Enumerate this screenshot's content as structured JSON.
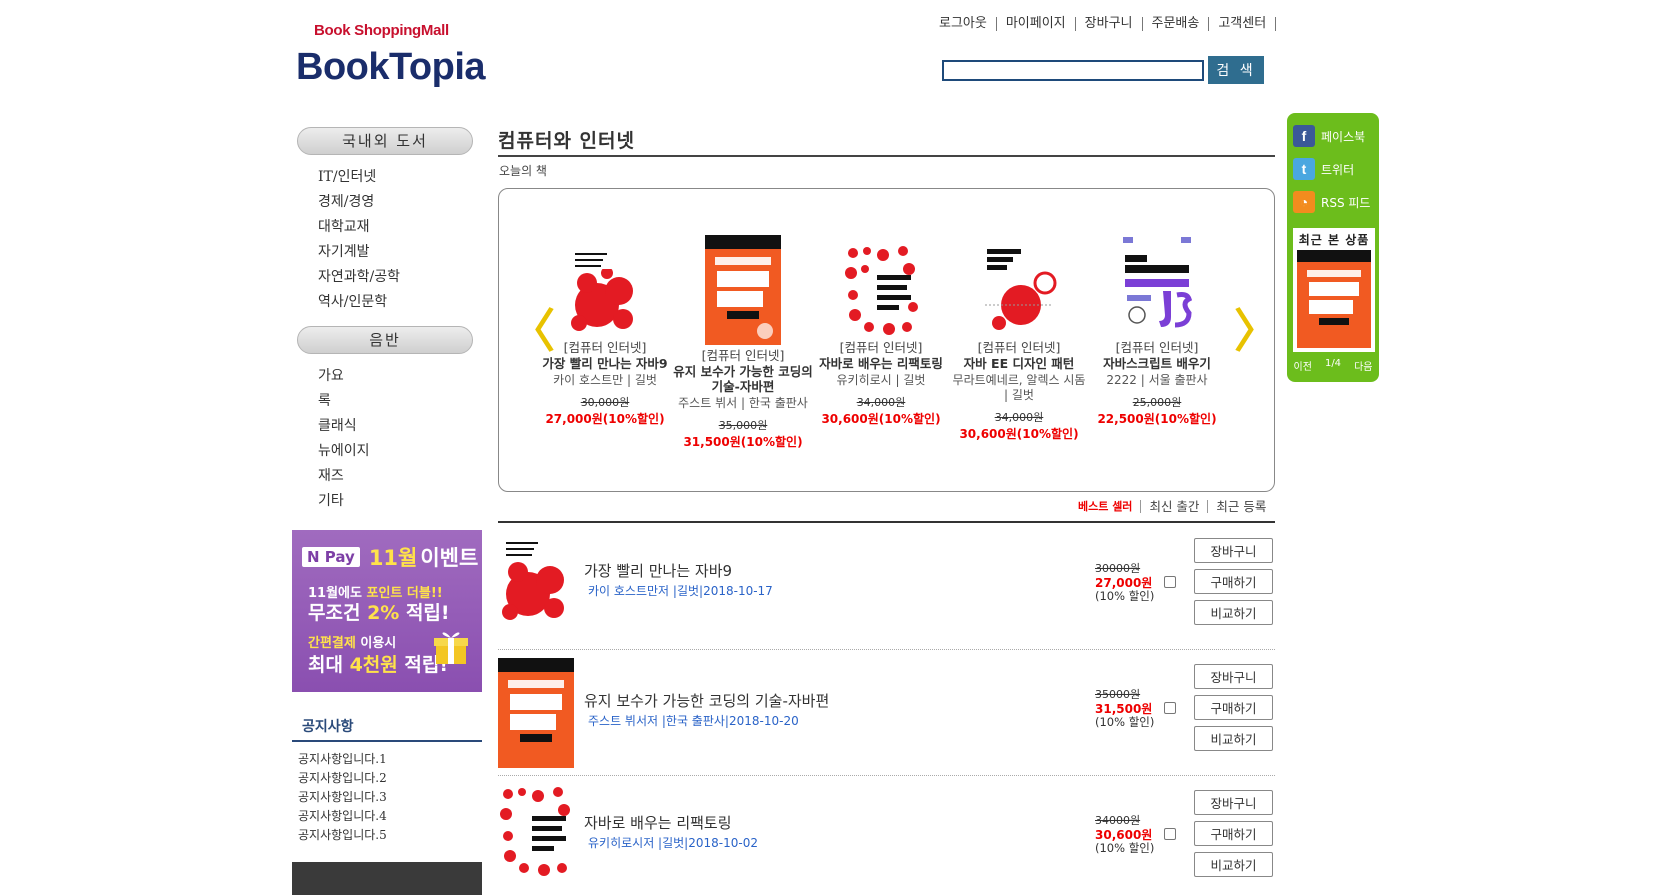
{
  "header": {
    "logo_sub": "Book ShoppingMall",
    "logo": "BookTopia",
    "nav": [
      "로그아웃",
      "마이페이지",
      "장바구니",
      "주문배송",
      "고객센터"
    ],
    "search": {
      "value": "",
      "button": "검 색"
    }
  },
  "sidebar": {
    "category1": "국내외 도서",
    "items1": [
      "IT/인터넷",
      "경제/경영",
      "대학교재",
      "자기계발",
      "자연과학/공학",
      "역사/인문학"
    ],
    "category2": "음반",
    "items2": [
      "가요",
      "록",
      "클래식",
      "뉴에이지",
      "재즈",
      "기타"
    ],
    "banner": {
      "npay": "N Pay",
      "month": "11월",
      "event": "이벤트",
      "line1a": "11월에도 ",
      "line1b": "포인트 더블!!",
      "line2a": "무조건 ",
      "line2b": "2%",
      "line2c": " 적립!",
      "line3a": "간편결제",
      "line3b": " 이용시",
      "line4a": "최대 ",
      "line4b": "4천원",
      "line4c": " 적립!"
    },
    "notice_title": "공지사항",
    "notices": [
      "공지사항입니다.1",
      "공지사항입니다.2",
      "공지사항입니다.3",
      "공지사항입니다.4",
      "공지사항입니다.5"
    ]
  },
  "main": {
    "title": "컴퓨터와 인터넷",
    "today": "오늘의 책",
    "carousel": {
      "prev": "〈",
      "next": "〉",
      "items": [
        {
          "cat": "[컴퓨터 인터넷]",
          "title": "가장 빨리 만나는 자바9",
          "author": "카이 호스트만 | 길벗",
          "orig": "30,000원",
          "sale": "27,000원(10%할인)"
        },
        {
          "cat": "[컴퓨터 인터넷]",
          "title": "유지 보수가 가능한 코딩의 기술-자바편",
          "author": "주스트 뷔서 | 한국 출판사",
          "orig": "35,000원",
          "sale": "31,500원(10%할인)"
        },
        {
          "cat": "[컴퓨터 인터넷]",
          "title": "자바로 배우는 리팩토링",
          "author": "유키히로시 | 길벗",
          "orig": "34,000원",
          "sale": "30,600원(10%할인)"
        },
        {
          "cat": "[컴퓨터 인터넷]",
          "title": "자바 EE 디자인 패턴",
          "author": "무라트예네르, 알렉스 시돔 | 길벗",
          "orig": "34,000원",
          "sale": "30,600원(10%할인)"
        },
        {
          "cat": "[컴퓨터 인터넷]",
          "title": "자바스크립트 배우기",
          "author": "2222 | 서울 출판사",
          "orig": "25,000원",
          "sale": "22,500원(10%할인)"
        }
      ]
    },
    "sort_tabs": [
      "베스트 셀러",
      "최신 출간",
      "최근 등록"
    ],
    "books": [
      {
        "title": "가장 빨리 만나는 자바9",
        "meta": "카이 호스트만저 |길벗|2018-10-17",
        "orig": "30000원",
        "sale": "27,000원",
        "disc": "(10% 할인)"
      },
      {
        "title": "유지 보수가 가능한 코딩의 기술-자바편",
        "meta": "주스트 뷔서저 |한국 출판사|2018-10-20",
        "orig": "35000원",
        "sale": "31,500원",
        "disc": "(10% 할인)"
      },
      {
        "title": "자바로 배우는 리팩토링",
        "meta": "유키히로시저 |길벗|2018-10-02",
        "orig": "34000원",
        "sale": "30,600원",
        "disc": "(10% 할인)"
      }
    ],
    "buttons": {
      "cart": "장바구니",
      "buy": "구매하기",
      "compare": "비교하기"
    }
  },
  "sns": {
    "facebook": "페이스북",
    "twitter": "트위터",
    "rss": "RSS 피드",
    "recent_title": "최근 본 상품",
    "pager_prev": "이전",
    "pager_page": "1/4",
    "pager_next": "다음"
  },
  "colors": {
    "accent": "#1a2d6b",
    "sale": "#ee0000",
    "sns": "#6cbd1c",
    "search_button": "#2f6d8f"
  }
}
